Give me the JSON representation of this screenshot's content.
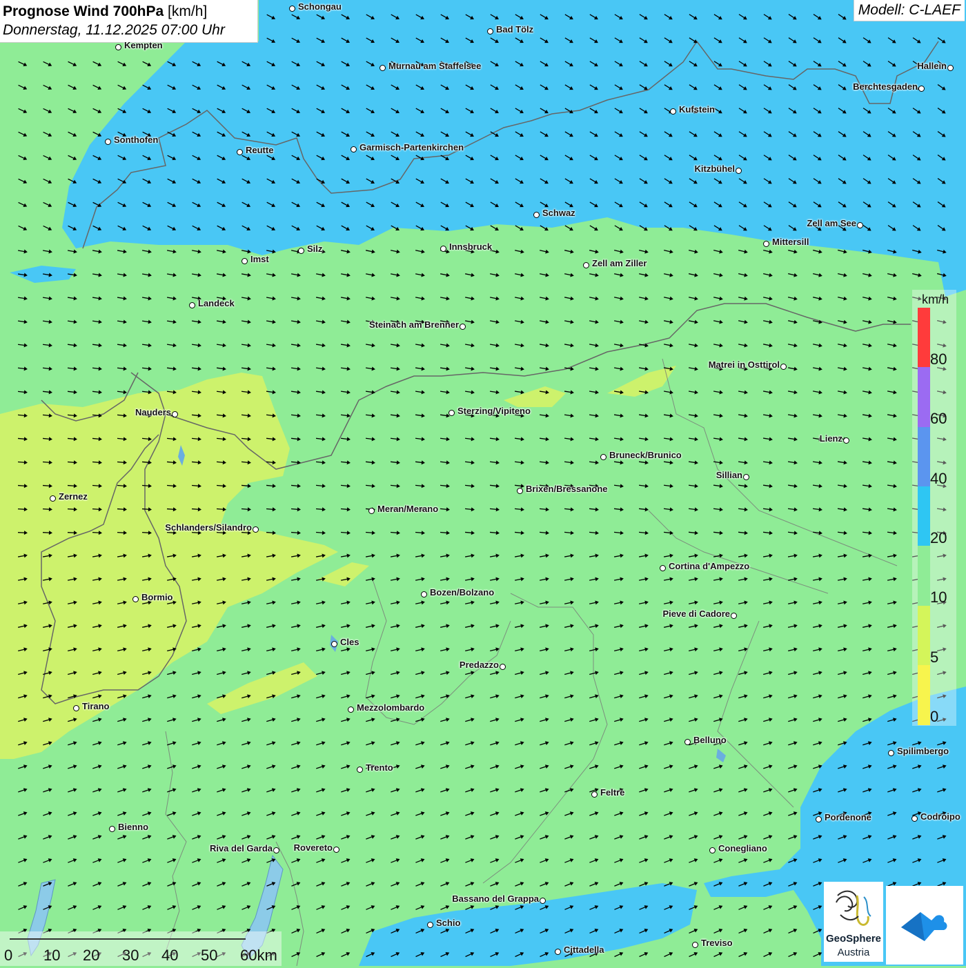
{
  "header": {
    "title_bold": "Prognose Wind 700hPa",
    "title_unit": "[km/h]",
    "datetime": "Donnerstag, 11.12.2025 07:00 Uhr",
    "model": "Modell: C-LAEF"
  },
  "legend": {
    "unit": "km/h",
    "labels": [
      "80",
      "60",
      "40",
      "20",
      "10",
      "5",
      "0"
    ],
    "colors": [
      "#ff3b3b",
      "#9b6bf2",
      "#5b95ef",
      "#2ec6f3",
      "#8fec96",
      "#d4f55a",
      "#f7f44d"
    ],
    "legend_colors_note": ""
  },
  "scalebar": {
    "labels": [
      "0",
      "10",
      "20",
      "30",
      "40",
      "50",
      "60km"
    ]
  },
  "logos": {
    "geosphere_line1": "GeoSphere",
    "geosphere_line2": "Austria"
  },
  "cities": [
    {
      "name": "Schongau"
    },
    {
      "name": "Bad Tölz"
    },
    {
      "name": "Kempten"
    },
    {
      "name": "Murnau am Staffelsee"
    },
    {
      "name": "Hallein"
    },
    {
      "name": "Berchtesgaden"
    },
    {
      "name": "Kufstein"
    },
    {
      "name": "Sonthofen"
    },
    {
      "name": "Reutte"
    },
    {
      "name": "Garmisch-Partenkirchen"
    },
    {
      "name": "Kitzbühel"
    },
    {
      "name": "Schwaz"
    },
    {
      "name": "Zell am See"
    },
    {
      "name": "Mittersill"
    },
    {
      "name": "Innsbruck"
    },
    {
      "name": "Silz"
    },
    {
      "name": "Imst"
    },
    {
      "name": "Zell am Ziller"
    },
    {
      "name": "Landeck"
    },
    {
      "name": "Steinach am Brenner"
    },
    {
      "name": "Matrei in Osttirol"
    },
    {
      "name": "Nauders"
    },
    {
      "name": "Sterzing/Vipiteno"
    },
    {
      "name": "Lienz"
    },
    {
      "name": "Bruneck/Brunico"
    },
    {
      "name": "Sillian"
    },
    {
      "name": "Brixen/Bressanone"
    },
    {
      "name": "Zernez"
    },
    {
      "name": "Meran/Merano"
    },
    {
      "name": "Schlanders/Silandro"
    },
    {
      "name": "Cortina d'Ampezzo"
    },
    {
      "name": "Bozen/Bolzano"
    },
    {
      "name": "Bormio"
    },
    {
      "name": "Pieve di Cadore"
    },
    {
      "name": "Cles"
    },
    {
      "name": "Predazzo"
    },
    {
      "name": "Tirano"
    },
    {
      "name": "Mezzolombardo"
    },
    {
      "name": "Belluno"
    },
    {
      "name": "Spilimbergo"
    },
    {
      "name": "Trento"
    },
    {
      "name": "Feltre"
    },
    {
      "name": "Pordenone"
    },
    {
      "name": "Codroipo"
    },
    {
      "name": "Bienno"
    },
    {
      "name": "Riva del Garda"
    },
    {
      "name": "Rovereto"
    },
    {
      "name": "Conegliano"
    },
    {
      "name": "Bassano del Grappa"
    },
    {
      "name": "Schio"
    },
    {
      "name": "Treviso"
    },
    {
      "name": "Cittadella"
    }
  ]
}
